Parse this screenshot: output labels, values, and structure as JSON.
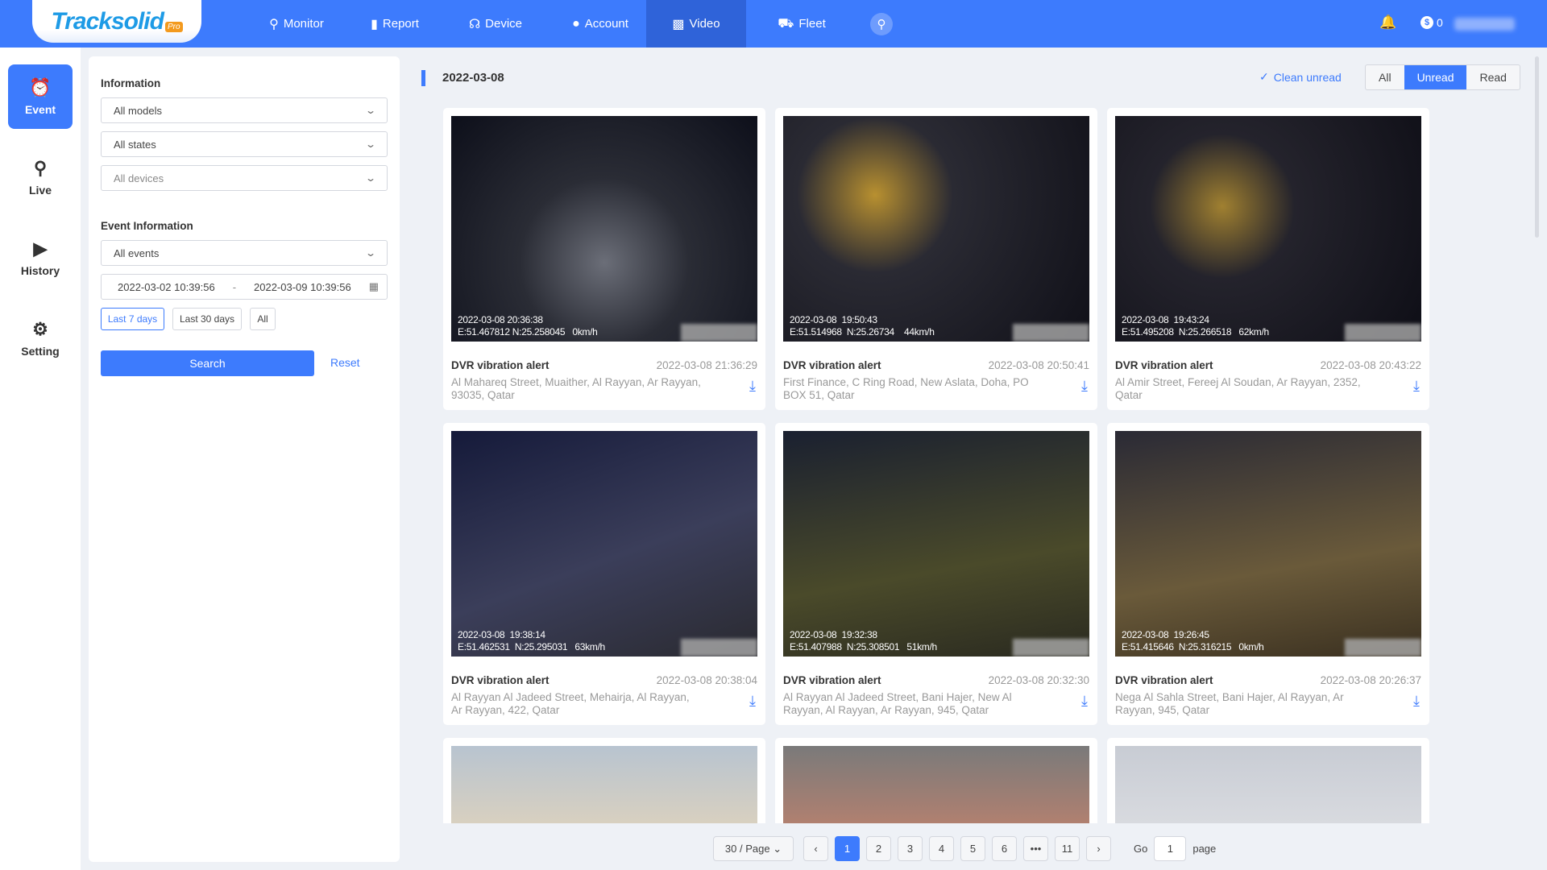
{
  "header": {
    "logo": "Tracksolid",
    "logo_badge": "Pro",
    "nav": [
      {
        "label": "Monitor",
        "icon": "pin-icon"
      },
      {
        "label": "Report",
        "icon": "chart-icon"
      },
      {
        "label": "Device",
        "icon": "device-icon"
      },
      {
        "label": "Account",
        "icon": "user-icon"
      },
      {
        "label": "Video",
        "icon": "video-icon",
        "active": true
      },
      {
        "label": "Fleet",
        "icon": "car-icon"
      }
    ],
    "balance": "0"
  },
  "sidebar": {
    "items": [
      {
        "label": "Event",
        "active": true
      },
      {
        "label": "Live"
      },
      {
        "label": "History"
      },
      {
        "label": "Setting"
      }
    ]
  },
  "filter": {
    "info_title": "Information",
    "models": "All models",
    "states": "All states",
    "devices": "All devices",
    "event_title": "Event Information",
    "events": "All events",
    "start": "2022-03-02 10:39:56",
    "sep": "-",
    "end": "2022-03-09 10:39:56",
    "quick": [
      "Last 7 days",
      "Last 30 days",
      "All"
    ],
    "search": "Search",
    "reset": "Reset"
  },
  "main": {
    "date": "2022-03-08",
    "clean_unread": "Clean unread",
    "tabs": [
      "All",
      "Unread",
      "Read"
    ],
    "active_tab": "Unread",
    "cards": [
      {
        "title": "DVR vibration alert",
        "time": "2022-03-08 21:36:29",
        "address": "Al Mahareq Street, Muaither, Al Rayyan, Ar Rayyan, 93035, Qatar",
        "overlay": "2022-03-08 20:36:38\nE:51.467812 N:25.258045   0km/h"
      },
      {
        "title": "DVR vibration alert",
        "time": "2022-03-08 20:50:41",
        "address": "First Finance, C Ring Road, New Aslata, Doha, PO BOX 51, Qatar",
        "overlay": "2022-03-08  19:50:43\nE:51.514968  N:25.26734    44km/h"
      },
      {
        "title": "DVR vibration alert",
        "time": "2022-03-08 20:43:22",
        "address": "Al Amir Street, Fereej Al Soudan, Ar Rayyan, 2352, Qatar",
        "overlay": "2022-03-08  19:43:24\nE:51.495208  N:25.266518   62km/h"
      },
      {
        "title": "DVR vibration alert",
        "time": "2022-03-08 20:38:04",
        "address": "Al Rayyan Al Jadeed Street, Mehairja, Al Rayyan, Ar Rayyan, 422, Qatar",
        "overlay": "2022-03-08  19:38:14\nE:51.462531  N:25.295031   63km/h"
      },
      {
        "title": "DVR vibration alert",
        "time": "2022-03-08 20:32:30",
        "address": "Al Rayyan Al Jadeed Street, Bani Hajer, New Al Rayyan, Al Rayyan, Ar Rayyan, 945, Qatar",
        "overlay": "2022-03-08  19:32:38\nE:51.407988  N:25.308501   51km/h"
      },
      {
        "title": "DVR vibration alert",
        "time": "2022-03-08 20:26:37",
        "address": "Nega Al Sahla Street, Bani Hajer, Al Rayyan, Ar Rayyan, 945, Qatar",
        "overlay": "2022-03-08  19:26:45\nE:51.415646  N:25.316215   0km/h"
      },
      {
        "title": "",
        "time": "",
        "address": "",
        "overlay": ""
      },
      {
        "title": "",
        "time": "",
        "address": "",
        "overlay": ""
      },
      {
        "title": "",
        "time": "",
        "address": "",
        "overlay": ""
      }
    ]
  },
  "pagination": {
    "page_size": "30 / Page",
    "pages": [
      "1",
      "2",
      "3",
      "4",
      "5",
      "6",
      "•••",
      "11"
    ],
    "current": "1",
    "go_label": "Go",
    "go_value": "1",
    "page_label": "page"
  }
}
